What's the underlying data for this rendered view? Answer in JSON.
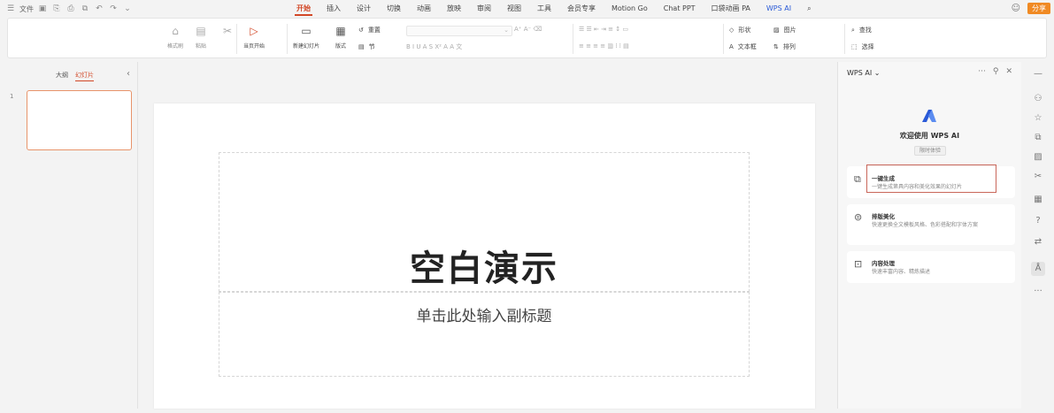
{
  "menubar": {
    "file_label": "文件",
    "tabs": [
      "开始",
      "插入",
      "设计",
      "切换",
      "动画",
      "放映",
      "审阅",
      "视图",
      "工具",
      "会员专享",
      "Motion Go",
      "Chat PPT",
      "口袋动画 PA",
      "WPS AI"
    ],
    "share_label": "分享"
  },
  "ribbon": {
    "format_painter": "格式刷",
    "paste": "粘贴",
    "play_from_current": "当页开始",
    "new_slide": "新建幻灯片",
    "layout": "版式",
    "section": "节",
    "reset": "重置",
    "shape": "形状",
    "picture": "图片",
    "textbox": "文本框",
    "arrange": "排列",
    "find": "查找",
    "select": "选择"
  },
  "left_panel": {
    "tab_outline": "大纲",
    "tab_slides": "幻灯片",
    "slide_number": "1"
  },
  "slide": {
    "title": "空白演示",
    "subtitle": "单击此处输入副标题"
  },
  "ai_panel": {
    "header": "WPS AI",
    "welcome": "欢迎使用 WPS AI",
    "badge": "限时体验",
    "cards": [
      {
        "title": "一键生成",
        "desc": "一键生成第具内容和美化效果的幻灯片"
      },
      {
        "title": "排版美化",
        "desc": "快速更换全文模板风格、色彩搭配和字体方案"
      },
      {
        "title": "内容处理",
        "desc": "快速丰富内容、精炼描述"
      }
    ]
  },
  "colors": {
    "accent": "#d24726",
    "share": "#f08a24",
    "thumb_border": "#e8946a",
    "highlight": "#c9665a"
  }
}
